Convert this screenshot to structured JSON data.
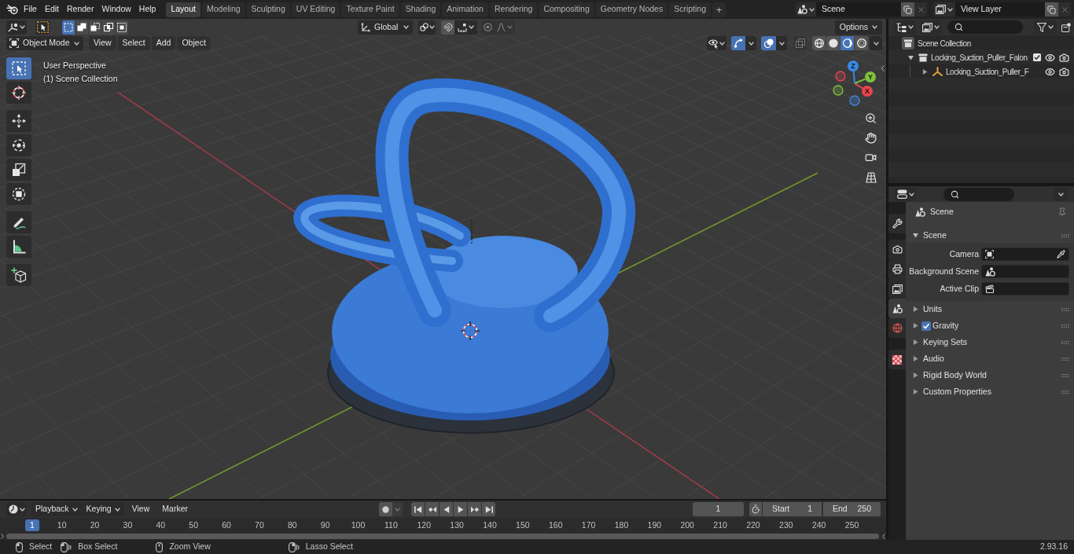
{
  "topbar": {
    "menus": [
      "File",
      "Edit",
      "Render",
      "Window",
      "Help"
    ],
    "workspaces": [
      {
        "label": "Layout",
        "selected": true
      },
      {
        "label": "Modeling",
        "selected": false
      },
      {
        "label": "Sculpting",
        "selected": false
      },
      {
        "label": "UV Editing",
        "selected": false
      },
      {
        "label": "Texture Paint",
        "selected": false
      },
      {
        "label": "Shading",
        "selected": false
      },
      {
        "label": "Animation",
        "selected": false
      },
      {
        "label": "Rendering",
        "selected": false
      },
      {
        "label": "Compositing",
        "selected": false
      },
      {
        "label": "Geometry Nodes",
        "selected": false
      },
      {
        "label": "Scripting",
        "selected": false
      }
    ],
    "add_workspace": "+",
    "scene": "Scene",
    "view_layer": "View Layer"
  },
  "tool_header": {
    "select_modes": [
      {
        "kind": "new",
        "selected": true
      },
      {
        "kind": "extend",
        "selected": false
      },
      {
        "kind": "subtract",
        "selected": false
      },
      {
        "kind": "difference",
        "selected": false
      },
      {
        "kind": "intersect",
        "selected": false
      }
    ],
    "orientation": "Global",
    "options": "Options"
  },
  "viewport_header": {
    "mode": "Object Mode",
    "menus": [
      "View",
      "Select",
      "Add",
      "Object"
    ],
    "gizmos": {
      "on": true
    },
    "overlays": {
      "on": true
    },
    "xray": {
      "on": false
    },
    "shading": [
      {
        "kind": "wireframe",
        "selected": false
      },
      {
        "kind": "solid",
        "selected": false
      },
      {
        "kind": "material",
        "selected": true
      },
      {
        "kind": "rendered",
        "selected": false
      }
    ]
  },
  "viewport": {
    "view_name": "User Perspective",
    "collection_label": "(1) Scene Collection",
    "tool_groups": [
      {
        "tools": [
          {
            "kind": "select_box",
            "selected": true
          },
          {
            "kind": "cursor",
            "selected": false
          }
        ]
      },
      {
        "tools": [
          {
            "kind": "move",
            "selected": false
          },
          {
            "kind": "rotate",
            "selected": false
          },
          {
            "kind": "scale",
            "selected": false
          },
          {
            "kind": "transform",
            "selected": false
          }
        ]
      },
      {
        "tools": [
          {
            "kind": "annotate",
            "selected": false
          },
          {
            "kind": "measure",
            "selected": false
          }
        ]
      },
      {
        "tools": [
          {
            "kind": "add_cube",
            "selected": false
          }
        ]
      }
    ],
    "gizmo_axes": [
      {
        "label": "X",
        "color": "#e8454f"
      },
      {
        "label": "Y",
        "color": "#7ec33c"
      },
      {
        "label": "Z",
        "color": "#3a8ae6"
      }
    ]
  },
  "outliner": {
    "tree": [
      {
        "label": "Scene Collection",
        "kind": "scene_collection",
        "children": [
          {
            "label": "Locking_Suction_Puller_Falon",
            "kind": "collection",
            "expanded": true,
            "checked": true,
            "children": [
              {
                "label": "Locking_Suction_Puller_F",
                "kind": "empty",
                "expanded": false
              }
            ]
          }
        ]
      }
    ]
  },
  "properties": {
    "tab_groups": [
      {
        "tabs": [
          {
            "kind": "tool",
            "selected": false
          }
        ]
      },
      {
        "tabs": [
          {
            "kind": "render",
            "selected": false
          },
          {
            "kind": "output",
            "selected": false
          },
          {
            "kind": "view_layer",
            "selected": false
          },
          {
            "kind": "scene",
            "selected": true
          },
          {
            "kind": "world",
            "selected": false
          }
        ]
      },
      {
        "tabs": [
          {
            "kind": "texture",
            "selected": false
          }
        ]
      }
    ],
    "context": "Scene",
    "panels": [
      {
        "label": "Scene",
        "expanded": true,
        "fields": [
          {
            "label": "Camera",
            "kind": "camera"
          },
          {
            "label": "Background Scene",
            "kind": "scene"
          },
          {
            "label": "Active Clip",
            "kind": "clip"
          }
        ]
      },
      {
        "label": "Units",
        "expanded": false
      },
      {
        "label": "Gravity",
        "expanded": false,
        "checkbox": {
          "checked": true
        }
      },
      {
        "label": "Keying Sets",
        "expanded": false
      },
      {
        "label": "Audio",
        "expanded": false
      },
      {
        "label": "Rigid Body World",
        "expanded": false
      },
      {
        "label": "Custom Properties",
        "expanded": false
      }
    ]
  },
  "timeline": {
    "menus": [
      {
        "label": "Playback",
        "kind": "dropdown"
      },
      {
        "label": "Keying",
        "kind": "dropdown"
      },
      {
        "label": "View",
        "kind": "menu"
      },
      {
        "label": "Marker",
        "kind": "menu"
      }
    ],
    "auto_keying": {
      "on": false
    },
    "current_frame": "1",
    "start": {
      "label": "Start",
      "value": "1"
    },
    "end": {
      "label": "End",
      "value": "250"
    },
    "ruler": [
      {
        "label": "1",
        "selected": true
      },
      {
        "label": "10",
        "selected": false
      },
      {
        "label": "20",
        "selected": false
      },
      {
        "label": "30",
        "selected": false
      },
      {
        "label": "40",
        "selected": false
      },
      {
        "label": "50",
        "selected": false
      },
      {
        "label": "60",
        "selected": false
      },
      {
        "label": "70",
        "selected": false
      },
      {
        "label": "80",
        "selected": false
      },
      {
        "label": "90",
        "selected": false
      },
      {
        "label": "100",
        "selected": false
      },
      {
        "label": "110",
        "selected": false
      },
      {
        "label": "120",
        "selected": false
      },
      {
        "label": "130",
        "selected": false
      },
      {
        "label": "140",
        "selected": false
      },
      {
        "label": "150",
        "selected": false
      },
      {
        "label": "160",
        "selected": false
      },
      {
        "label": "170",
        "selected": false
      },
      {
        "label": "180",
        "selected": false
      },
      {
        "label": "190",
        "selected": false
      },
      {
        "label": "200",
        "selected": false
      },
      {
        "label": "210",
        "selected": false
      },
      {
        "label": "220",
        "selected": false
      },
      {
        "label": "230",
        "selected": false
      },
      {
        "label": "240",
        "selected": false
      },
      {
        "label": "250",
        "selected": false
      }
    ]
  },
  "status_bar": {
    "hints": [
      {
        "label": "Select",
        "kind": "left_click"
      },
      {
        "label": "Box Select",
        "kind": "left_drag"
      },
      {
        "label": "Zoom View",
        "kind": "middle_drag"
      },
      {
        "label": "Lasso Select",
        "kind": "right_drag"
      }
    ],
    "version": "2.93.16"
  }
}
